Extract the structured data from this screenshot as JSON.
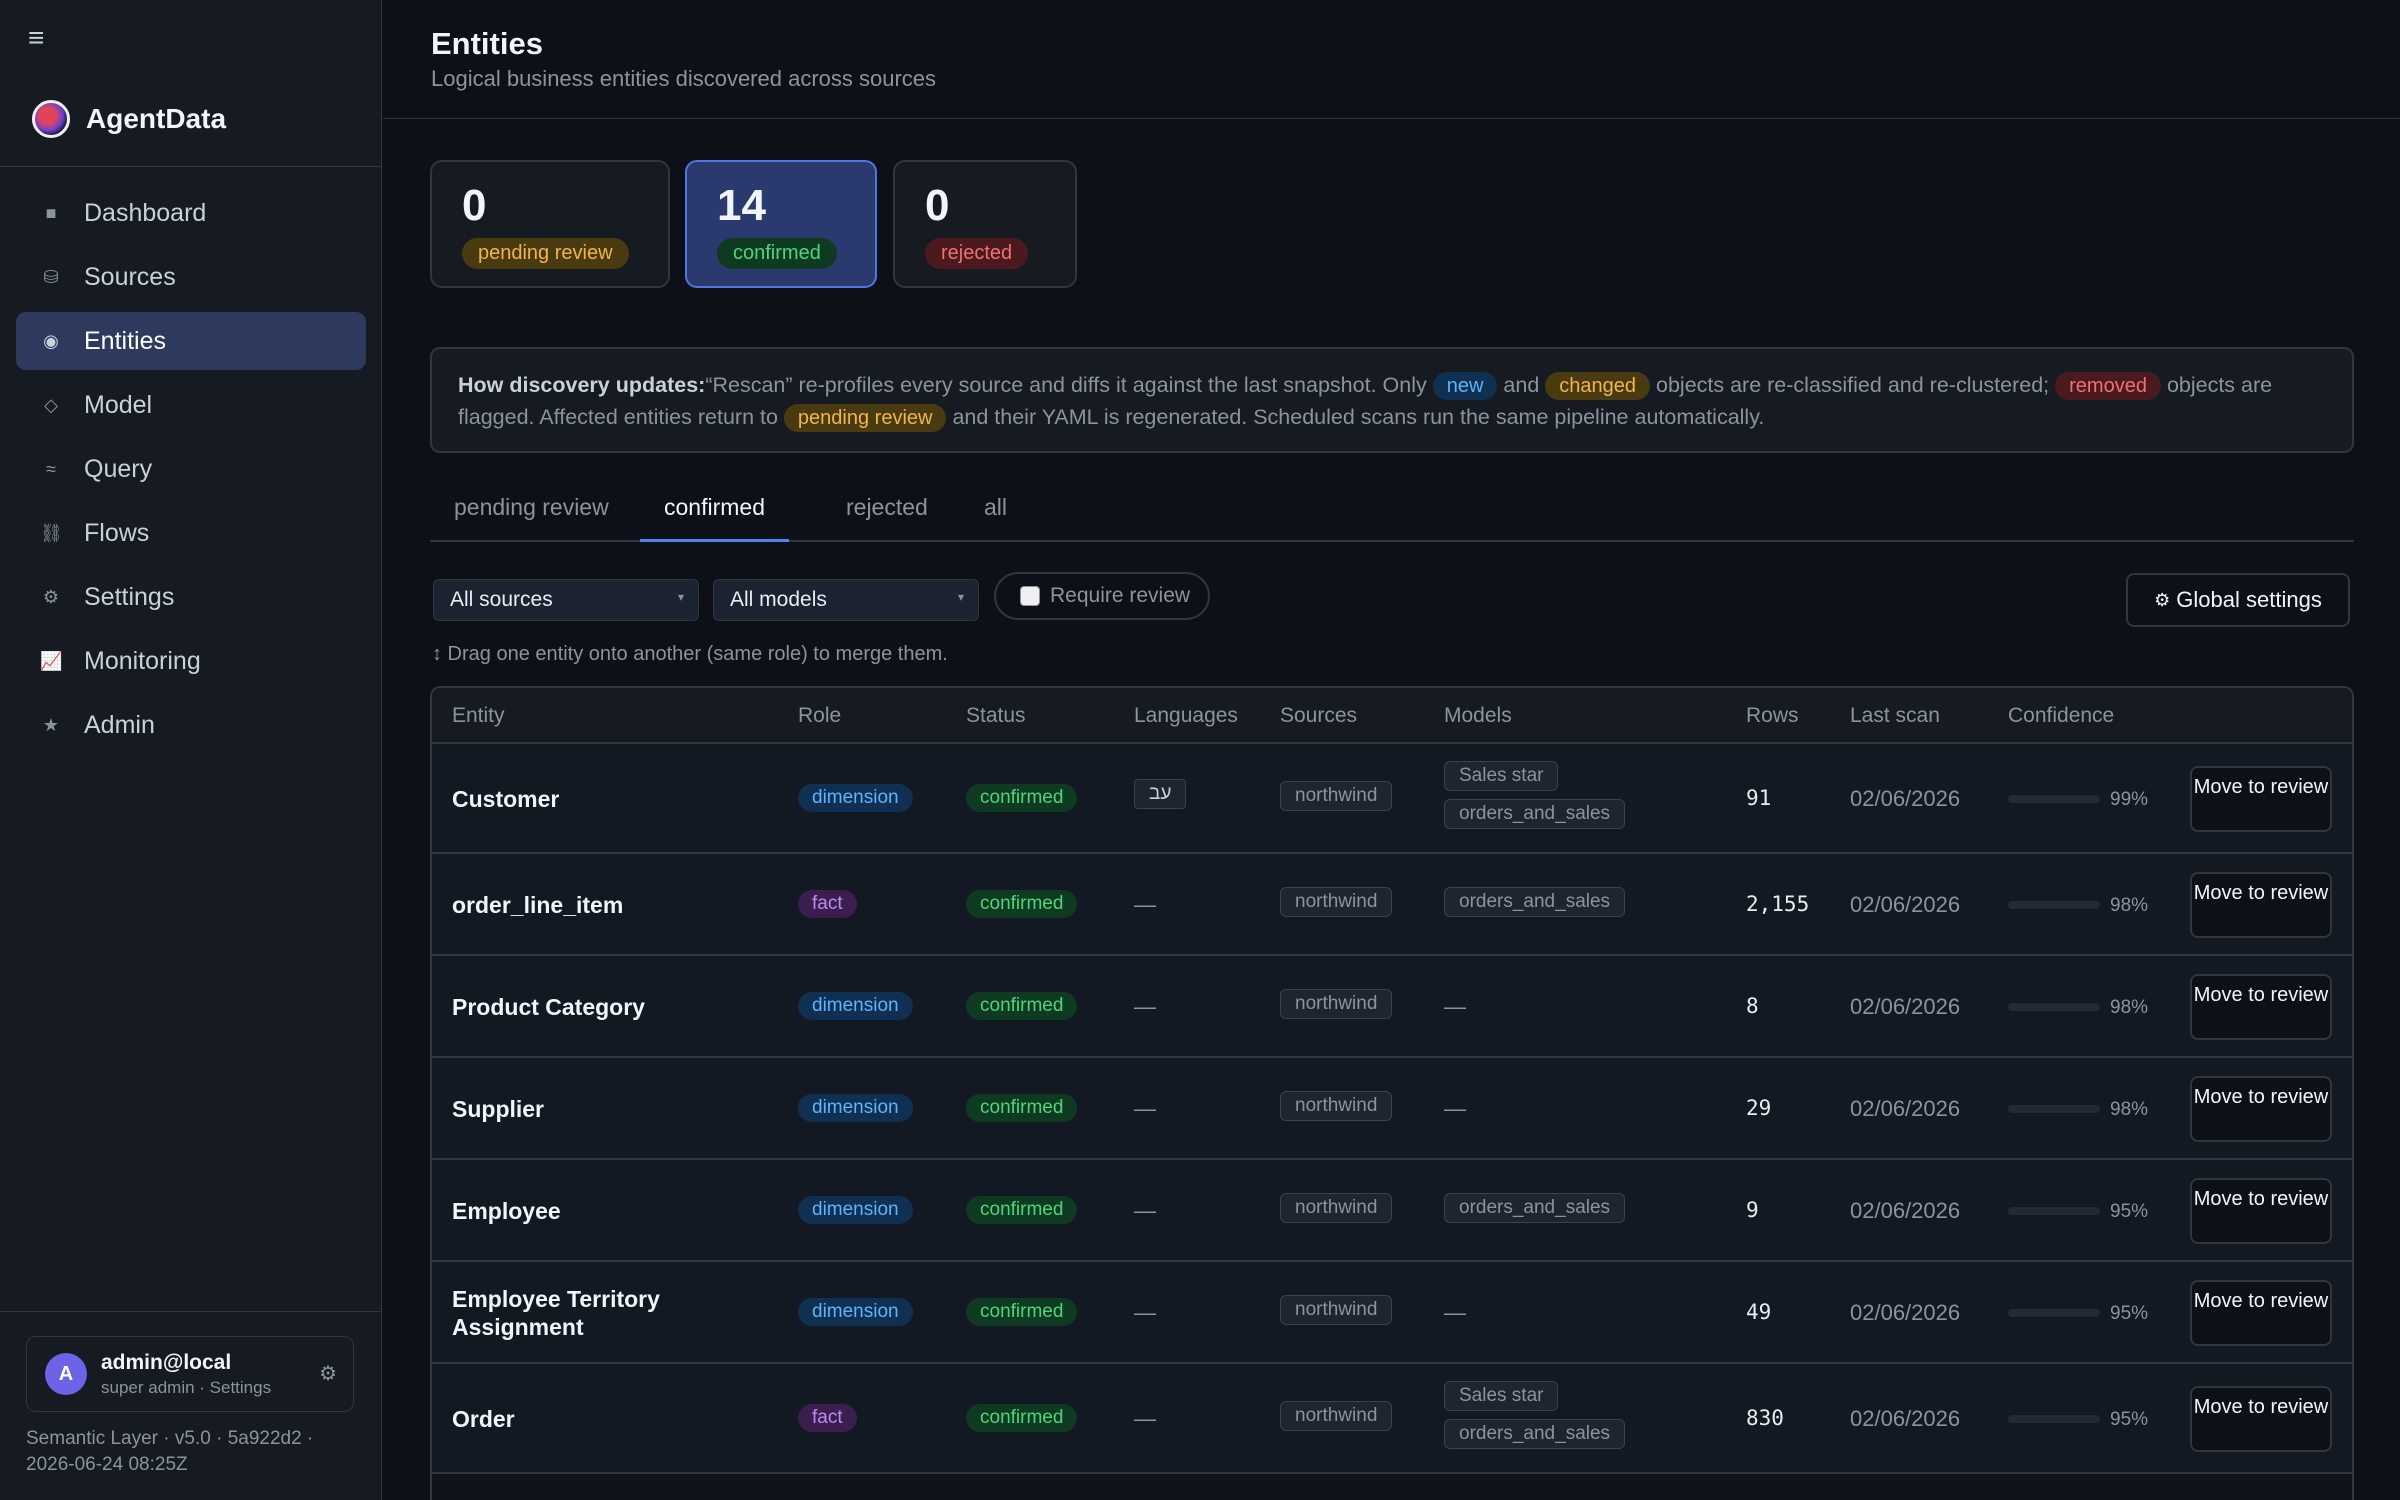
{
  "app": {
    "name": "AgentData",
    "menu_icon": "hamburger-icon"
  },
  "sidebar": {
    "items": [
      {
        "label": "Dashboard",
        "icon": "■"
      },
      {
        "label": "Sources",
        "icon": "⛁"
      },
      {
        "label": "Entities",
        "icon": "◉"
      },
      {
        "label": "Model",
        "icon": "◇"
      },
      {
        "label": "Query",
        "icon": "≈"
      },
      {
        "label": "Flows",
        "icon": "⛓"
      },
      {
        "label": "Settings",
        "icon": "⚙"
      },
      {
        "label": "Monitoring",
        "icon": "📈"
      },
      {
        "label": "Admin",
        "icon": "★"
      }
    ],
    "user": {
      "initial": "A",
      "name": "admin@local",
      "sub": "super admin · Settings"
    },
    "version_line1": "Semantic Layer · v5.0 · 5a922d2 ·",
    "version_line2": "2026-06-24 08:25Z"
  },
  "header": {
    "title": "Entities",
    "subtitle": "Logical business entities discovered across sources"
  },
  "stats": [
    {
      "count": "0",
      "label": "pending review"
    },
    {
      "count": "14",
      "label": "confirmed"
    },
    {
      "count": "0",
      "label": "rejected"
    }
  ],
  "info": {
    "heading": "How discovery updates:",
    "t1": "“Rescan” re-profiles every source and diffs it against the last snapshot. Only",
    "new": "new",
    "and": "and",
    "changed": "changed",
    "t2": "objects are re-classified and re-clustered;",
    "removed": "removed",
    "t3": "objects are flagged. Affected entities return to",
    "pending": "pending review",
    "t4": "and their YAML is regenerated. Scheduled scans run the same pipeline automatically."
  },
  "tabs": [
    "pending review",
    "confirmed",
    "rejected",
    "all"
  ],
  "filters": {
    "sources": "All sources",
    "models": "All models",
    "require_review": "Require review",
    "global_settings": "Global settings"
  },
  "drag_hint": "↕ Drag one entity onto another (same role) to merge them.",
  "table": {
    "headers": [
      "Entity",
      "Role",
      "Status",
      "Languages",
      "Sources",
      "Models",
      "Rows",
      "Last scan",
      "Confidence"
    ],
    "rows": [
      {
        "entity": "Customer",
        "role": "dimension",
        "status": "confirmed",
        "languages": "עב",
        "source": "northwind",
        "models": [
          "Sales star",
          "orders_and_sales"
        ],
        "rows": "91",
        "last_scan": "02/06/2026",
        "confidence": "99%",
        "action": "Move to review"
      },
      {
        "entity": "order_line_item",
        "role": "fact",
        "status": "confirmed",
        "languages": "—",
        "source": "northwind",
        "models": [
          "orders_and_sales"
        ],
        "rows": "2,155",
        "last_scan": "02/06/2026",
        "confidence": "98%",
        "action": "Move to review"
      },
      {
        "entity": "Product Category",
        "role": "dimension",
        "status": "confirmed",
        "languages": "—",
        "source": "northwind",
        "models": [],
        "rows": "8",
        "last_scan": "02/06/2026",
        "confidence": "98%",
        "action": "Move to review"
      },
      {
        "entity": "Supplier",
        "role": "dimension",
        "status": "confirmed",
        "languages": "—",
        "source": "northwind",
        "models": [],
        "rows": "29",
        "last_scan": "02/06/2026",
        "confidence": "98%",
        "action": "Move to review"
      },
      {
        "entity": "Employee",
        "role": "dimension",
        "status": "confirmed",
        "languages": "—",
        "source": "northwind",
        "models": [
          "orders_and_sales"
        ],
        "rows": "9",
        "last_scan": "02/06/2026",
        "confidence": "95%",
        "action": "Move to review"
      },
      {
        "entity": "Employee Territory Assignment",
        "role": "dimension",
        "status": "confirmed",
        "languages": "—",
        "source": "northwind",
        "models": [],
        "rows": "49",
        "last_scan": "02/06/2026",
        "confidence": "95%",
        "action": "Move to review"
      },
      {
        "entity": "Order",
        "role": "fact",
        "status": "confirmed",
        "languages": "—",
        "source": "northwind",
        "models": [
          "Sales star",
          "orders_and_sales"
        ],
        "rows": "830",
        "last_scan": "02/06/2026",
        "confidence": "95%",
        "action": "Move to review"
      }
    ],
    "empty_dash": "—"
  },
  "colors": {
    "accent": "#4a86f0",
    "dimension": "#5ab4ff",
    "fact": "#c08af0",
    "confirmed": "#4cd67a"
  }
}
